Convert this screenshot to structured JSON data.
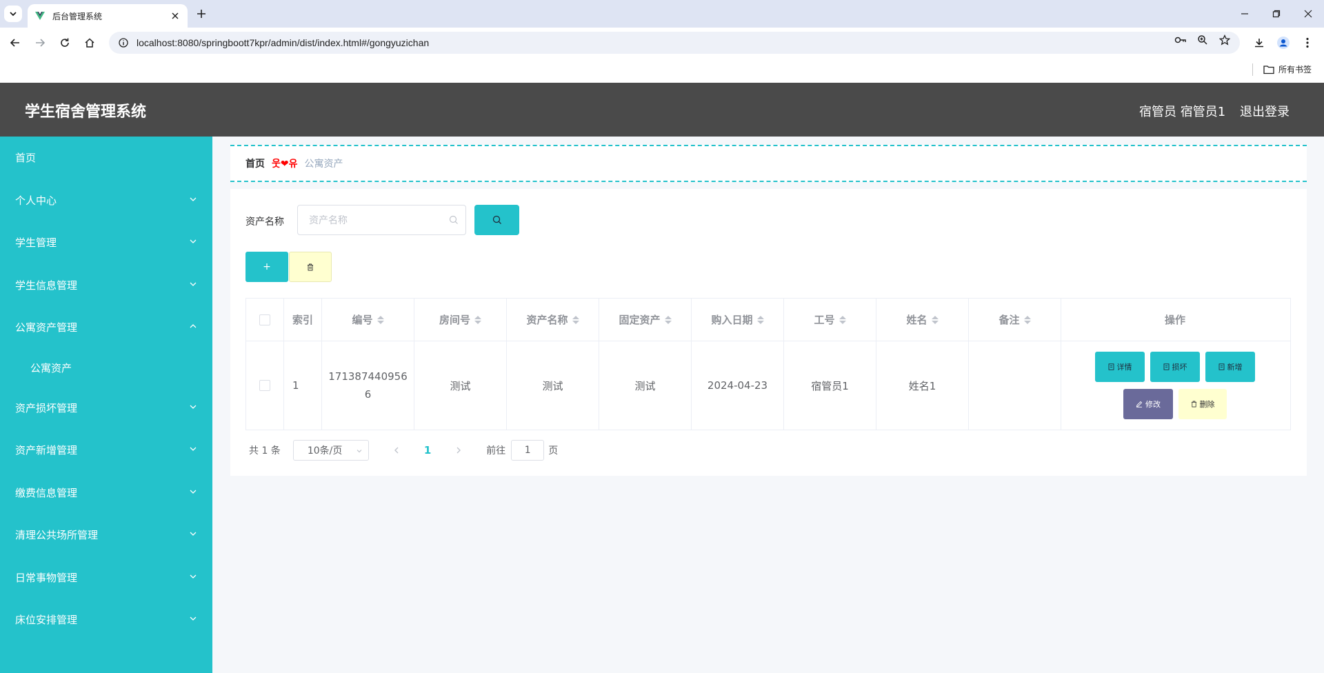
{
  "browser": {
    "tab_title": "后台管理系统",
    "url": "localhost:8080/springboott7kpr/admin/dist/index.html#/gongyuzichan",
    "bookmarks_all": "所有书签"
  },
  "header": {
    "title": "学生宿舍管理系统",
    "user": "宿管员 宿管员1",
    "logout": "退出登录"
  },
  "sidebar": {
    "items": [
      {
        "label": "首页"
      },
      {
        "label": "个人中心"
      },
      {
        "label": "学生管理"
      },
      {
        "label": "学生信息管理"
      },
      {
        "label": "公寓资产管理"
      },
      {
        "label": "公寓资产"
      },
      {
        "label": "资产损坏管理"
      },
      {
        "label": "资产新增管理"
      },
      {
        "label": "缴费信息管理"
      },
      {
        "label": "清理公共场所管理"
      },
      {
        "label": "日常事物管理"
      },
      {
        "label": "床位安排管理"
      }
    ]
  },
  "breadcrumb": {
    "home": "首页",
    "separator": "웃❤유",
    "current": "公寓资产"
  },
  "search": {
    "label": "资产名称",
    "placeholder": "资产名称"
  },
  "actions": {
    "add": "+"
  },
  "table": {
    "headers": [
      "索引",
      "编号",
      "房间号",
      "资产名称",
      "固定资产",
      "购入日期",
      "工号",
      "姓名",
      "备注",
      "操作"
    ],
    "rows": [
      {
        "index": "1",
        "code": "1713874409566",
        "room": "测试",
        "name": "测试",
        "fixed": "测试",
        "date": "2024-04-23",
        "staff_no": "宿管员1",
        "person": "姓名1",
        "note": ""
      }
    ],
    "row_actions": {
      "detail": "详情",
      "damage": "损坏",
      "add_new": "新增",
      "edit": "修改",
      "delete": "删除"
    }
  },
  "pagination": {
    "total": "共 1 条",
    "page_size": "10条/页",
    "current_page": "1",
    "goto_label": "前往",
    "goto_value": "1",
    "goto_unit": "页"
  },
  "colors": {
    "accent": "#24c2cb",
    "header_bg": "#4a4a4a",
    "edit_button": "#6a6a9a",
    "delete_button": "#ffffd0",
    "breadcrumb_separator": "#ff0000"
  }
}
